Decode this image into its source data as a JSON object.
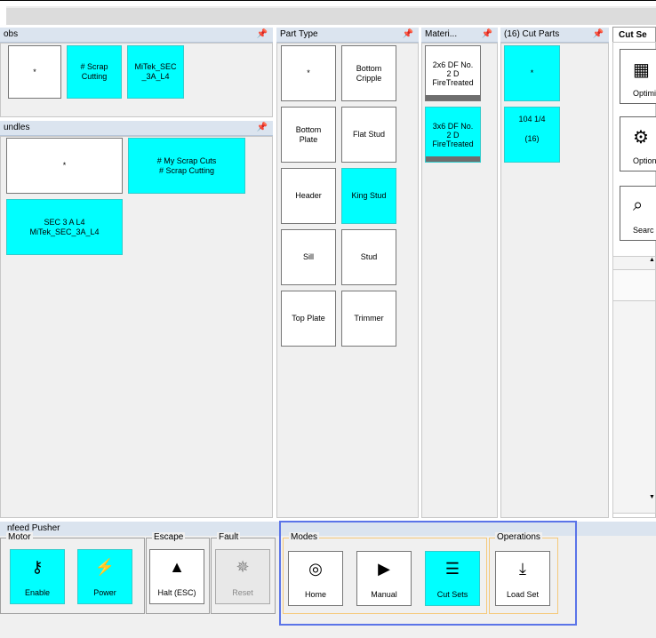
{
  "jobs": {
    "title": "obs",
    "tiles": [
      {
        "label": "*",
        "active": false
      },
      {
        "label": "# Scrap\nCutting",
        "active": true
      },
      {
        "label": "MiTek_SEC\n_3A_L4",
        "active": true
      }
    ]
  },
  "bundles": {
    "title": "undles",
    "tiles": [
      {
        "label": "*",
        "active": false
      },
      {
        "label": "# My Scrap Cuts\n# Scrap Cutting",
        "active": true
      },
      {
        "label": "SEC 3 A L4\nMiTek_SEC_3A_L4",
        "active": true
      }
    ]
  },
  "part_type": {
    "title": "Part Type",
    "tiles": [
      {
        "label": "*",
        "active": false
      },
      {
        "label": "Bottom\nCripple",
        "active": false
      },
      {
        "label": "Bottom\nPlate",
        "active": false
      },
      {
        "label": "Flat Stud",
        "active": false
      },
      {
        "label": "Header",
        "active": false
      },
      {
        "label": "King Stud",
        "active": true
      },
      {
        "label": "Sill",
        "active": false
      },
      {
        "label": "Stud",
        "active": false
      },
      {
        "label": "Top Plate",
        "active": false
      },
      {
        "label": "Trimmer",
        "active": false
      }
    ]
  },
  "materials": {
    "title": "Materi...",
    "tiles": [
      {
        "label": "2x6 DF No.\n2 D\nFireTreated",
        "active": false
      },
      {
        "label": "3x6 DF No.\n2 D\nFireTreated",
        "active": true
      }
    ]
  },
  "cut_parts": {
    "title": "(16) Cut Parts",
    "tiles": [
      {
        "label": "*",
        "active": true
      },
      {
        "label": "104 1/4\n\n(16)",
        "active": true
      }
    ]
  },
  "cut_sets_panel": {
    "tab_label": "Cut Se",
    "buttons": [
      {
        "icon": "grid-icon",
        "label": "Optimi"
      },
      {
        "icon": "gear-icon",
        "label": "Option"
      },
      {
        "icon": "search-icon",
        "label": "Searc"
      }
    ]
  },
  "bottom": {
    "header": "nfeed Pusher",
    "groups": {
      "motor": "Motor",
      "escape": "Escape",
      "fault": "Fault",
      "modes": "Modes",
      "operations": "Operations"
    },
    "buttons": {
      "enable": {
        "label": "Enable",
        "icon": "key-icon"
      },
      "power": {
        "label": "Power",
        "icon": "lightning-icon"
      },
      "halt": {
        "label": "Halt (ESC)",
        "icon": "warning-icon"
      },
      "reset": {
        "label": "Reset",
        "icon": "burst-icon"
      },
      "home": {
        "label": "Home",
        "icon": "target-icon"
      },
      "manual": {
        "label": "Manual",
        "icon": "play-circle-icon"
      },
      "cut_sets": {
        "label": "Cut Sets",
        "icon": "list-icon"
      },
      "load_set": {
        "label": "Load Set",
        "icon": "download-icon"
      }
    }
  },
  "pin_glyph": "↑",
  "colors": {
    "active": "#00ffff",
    "highlight": "#5b74e8"
  }
}
